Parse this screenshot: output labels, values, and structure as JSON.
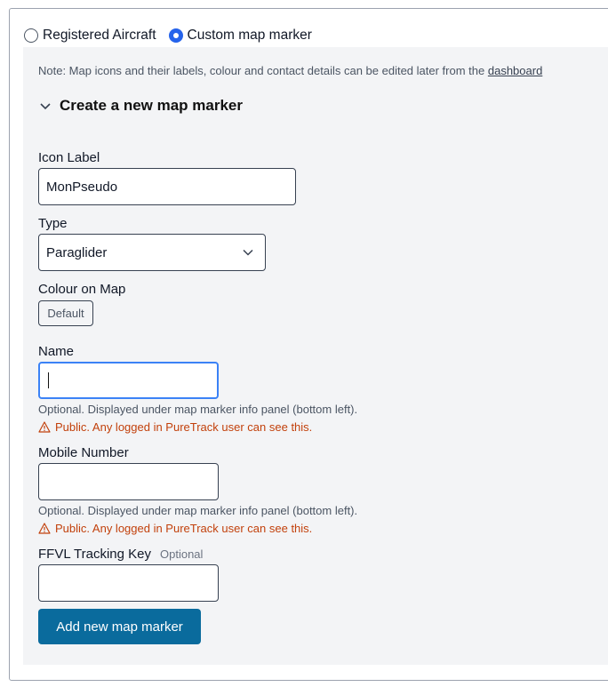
{
  "radio_group": {
    "options": [
      {
        "label": "Registered Aircraft",
        "checked": false
      },
      {
        "label": "Custom map marker",
        "checked": true
      }
    ]
  },
  "note": {
    "text": "Note: Map icons and their labels, colour and contact details can be edited later from the ",
    "link": "dashboard"
  },
  "section": {
    "title": "Create a new map marker",
    "icon": "chevron-down-icon"
  },
  "fields": {
    "icon_label": {
      "label": "Icon Label",
      "value": "MonPseudo"
    },
    "type": {
      "label": "Type",
      "value": "Paraglider",
      "icon": "chevron-down-icon"
    },
    "colour": {
      "label": "Colour on Map",
      "button": "Default"
    },
    "name": {
      "label": "Name",
      "value": "",
      "help": "Optional. Displayed under map marker info panel (bottom left).",
      "warning": "Public. Any logged in PureTrack user can see this."
    },
    "mobile": {
      "label": "Mobile Number",
      "value": "",
      "help": "Optional. Displayed under map marker info panel (bottom left).",
      "warning": "Public. Any logged in PureTrack user can see this."
    },
    "ffvl": {
      "label": "FFVL Tracking Key",
      "optional": "Optional",
      "value": ""
    }
  },
  "submit": {
    "label": "Add new map marker"
  },
  "colors": {
    "accent": "#2563eb",
    "button": "#0a6b9d",
    "warning": "#c2410c",
    "panel": "#f3f4f6"
  }
}
